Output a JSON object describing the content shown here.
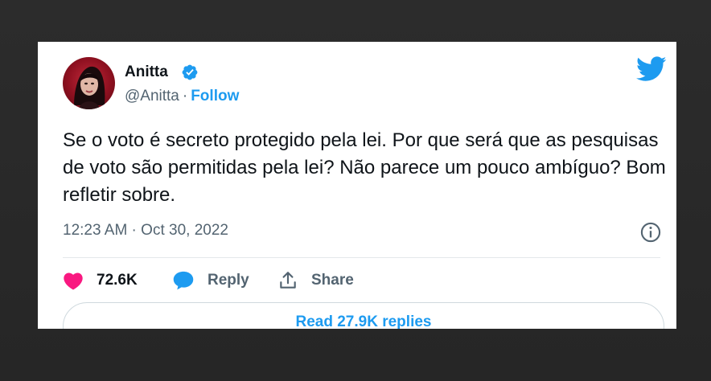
{
  "tweet": {
    "author": {
      "name": "Anitta",
      "handle": "@Anitta",
      "separator": "·",
      "follow_label": "Follow",
      "verified": true
    },
    "text": "Se o voto é secreto protegido pela lei. Por que será que as pesquisas de voto são permitidas pela lei? Não parece um pouco ambíguo? Bom refletir sobre.",
    "timestamp": "12:23 AM · Oct 30, 2022",
    "likes": "72.6K",
    "reply_label": "Reply",
    "share_label": "Share",
    "read_replies_label": "Read 27.9K replies"
  },
  "icons": {
    "logo": "twitter-bird-icon",
    "verified": "verified-badge-icon",
    "info": "info-icon",
    "like": "heart-icon",
    "reply": "speech-bubble-icon",
    "share": "share-upload-icon"
  },
  "colors": {
    "accent": "#1d9bf0",
    "like": "#f91880",
    "text": "#0f1419",
    "muted": "#536471",
    "frame": "#2b2b2b"
  }
}
